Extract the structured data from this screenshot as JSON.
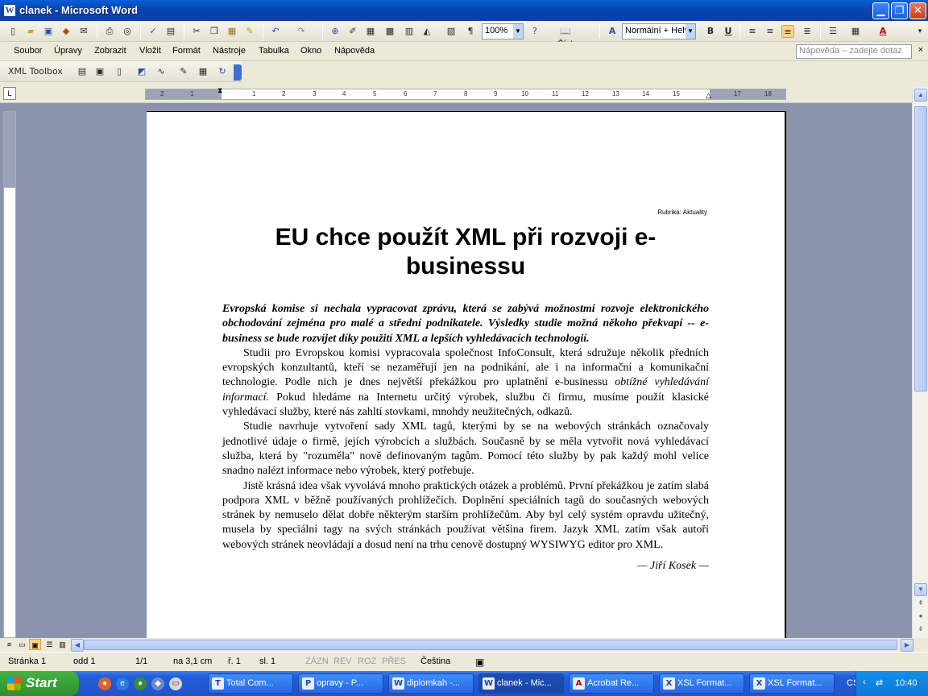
{
  "window": {
    "title": "clanek - Microsoft Word",
    "icon": "W",
    "minimize": "▁",
    "restore": "❐",
    "close": "✕"
  },
  "toolbar1": {
    "zoom": "100%",
    "read_label": "Číst",
    "style": "Normální + Helv",
    "bold": "B",
    "underline": "U",
    "font_color_glyph": "A"
  },
  "menu": {
    "items": [
      "Soubor",
      "Úpravy",
      "Zobrazit",
      "Vložit",
      "Formát",
      "Nástroje",
      "Tabulka",
      "Okno",
      "Nápověda"
    ],
    "help_placeholder": "Nápověda – zadejte dotaz",
    "close": "×"
  },
  "toolbar2": {
    "xml_toolbox": "XML Toolbox"
  },
  "ruler": {
    "corner": "L",
    "ticks": [
      "2",
      "1",
      "1",
      "2",
      "3",
      "4",
      "5",
      "6",
      "7",
      "8",
      "9",
      "10",
      "11",
      "12",
      "13",
      "14",
      "15",
      "16",
      "17",
      "18"
    ]
  },
  "document": {
    "rubrika": "Rubrika: Aktuality",
    "headline": "EU chce použít XML při rozvoji e-businessu",
    "lead": "Evropská komise si nechala vypracovat zprávu, která se zabývá možnostmi rozvoje elektronického obchodování zejména pro malé a střední podnikatele. Výsledky studie možná někoho překvapí -- e-business se bude rozvíjet díky použití XML a lepších vyhledávacích technologií.",
    "p1_a": "Studii pro Evropskou komisi vypracovala společnost InfoConsult, která sdružuje několik předních evropských konzultantů, kteří se nezaměřují jen na podnikání, ale i na informační a komunikační technologie. Podle nich je dnes největší překážkou pro uplatnění e-businessu ",
    "p1_em": "obtížné vyhledávání informací.",
    "p1_b": " Pokud hledáme na Internetu určitý výrobek, službu či firmu, musíme použít klasické vyhledávací služby, které nás zahltí stovkami, mnohdy neužitečných, odkazů.",
    "p2": "Studie navrhuje vytvoření sady XML tagů, kterými by se na webových stránkách označovaly jednotlivé údaje o firmě, jejích výrobcích a službách. Současně by se měla vytvořit nová vyhledávací služba, která by \"rozuměla\" nově definovaným tagům. Pomocí této služby by pak každý mohl velice snadno nalézt informace nebo výrobek, který potřebuje.",
    "p3": "Jistě krásná idea však vyvolává mnoho praktických otázek a problémů. První překážkou je zatím slabá podpora XML v běžně používaných prohlížečích. Doplnění speciálních tagů do současných webových stránek by nemuselo dělat dobře některým starším prohlížečům. Aby byl celý systém opravdu užitečný, musela by speciální tagy na svých stránkách používat většina firem. Jazyk XML zatím však autoři webových stránek neovládají a dosud není na trhu cenově dostupný WYSIWYG editor pro XML.",
    "author": "— Jiří Kosek —"
  },
  "status": {
    "page": "Stránka 1",
    "section": "odd 1",
    "pages": "1/1",
    "position": "na 3,1 cm",
    "line": "ř. 1",
    "column": "sl. 1",
    "rec": "ZÁZN",
    "trk": "REV",
    "ext": "ROZ",
    "ovr": "PŘES",
    "language": "Čeština"
  },
  "taskbar": {
    "start": "Start",
    "tasks": [
      {
        "label": "Total Com...",
        "icon": "T",
        "active": false
      },
      {
        "label": "opravy - P...",
        "icon": "P",
        "active": false
      },
      {
        "label": "diplomkah -...",
        "icon": "W",
        "active": false
      },
      {
        "label": "clanek - Mic...",
        "icon": "W",
        "active": true
      },
      {
        "label": "Acrobat Re...",
        "icon": "A",
        "active": false
      },
      {
        "label": "XSL Format...",
        "icon": "X",
        "active": false
      },
      {
        "label": "XSL Format...",
        "icon": "X",
        "active": false
      }
    ],
    "language": "CS",
    "clock": "10:40"
  }
}
